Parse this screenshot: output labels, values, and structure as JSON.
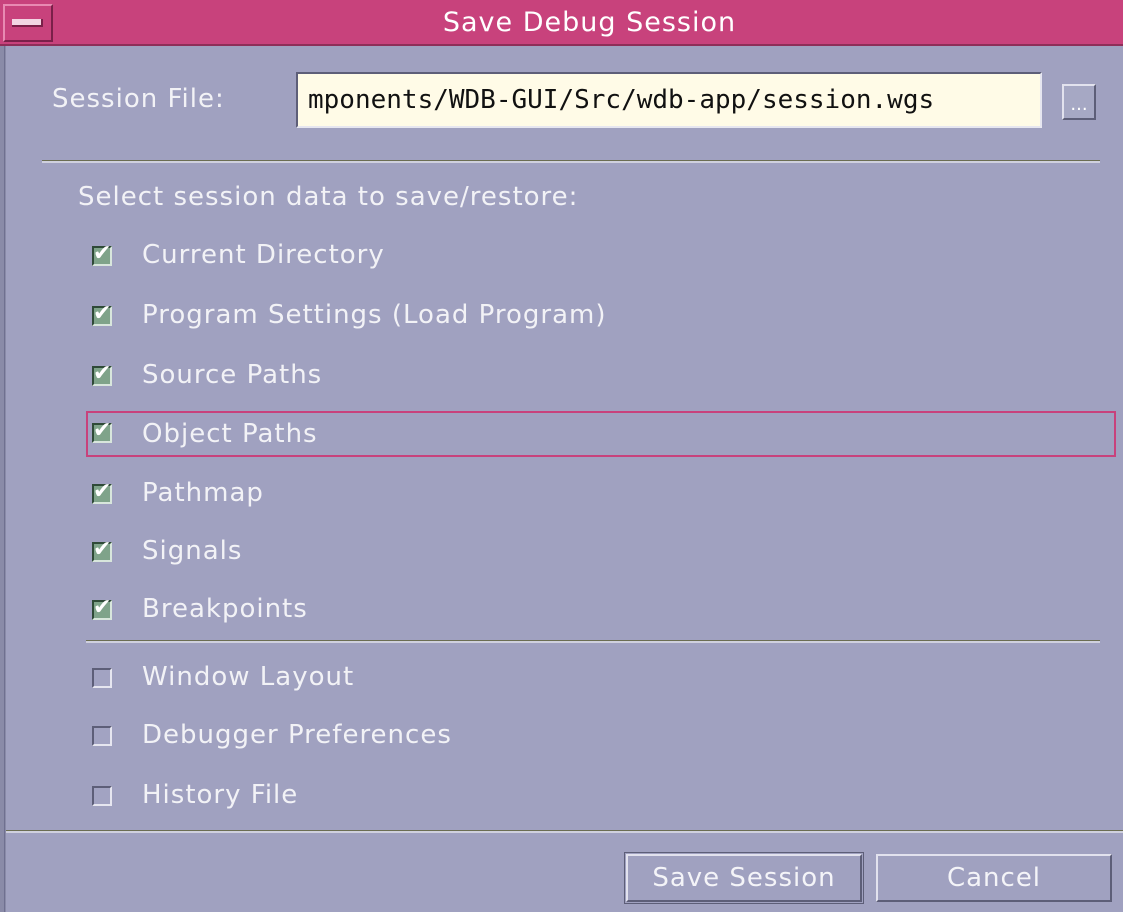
{
  "window": {
    "title": "Save Debug Session"
  },
  "session_file": {
    "label": "Session File:",
    "value": "mponents/WDB-GUI/Src/wdb-app/session.wgs",
    "browse_label": "..."
  },
  "section_heading": "Select session data to save/restore:",
  "options": [
    {
      "label": "Current Directory",
      "checked": true
    },
    {
      "label": "Program Settings (Load Program)",
      "checked": true
    },
    {
      "label": "Source Paths",
      "checked": true
    },
    {
      "label": "Object Paths",
      "checked": true,
      "focused": true
    },
    {
      "label": "Pathmap",
      "checked": true
    },
    {
      "label": "Signals",
      "checked": true
    },
    {
      "label": "Breakpoints",
      "checked": true
    },
    {
      "label": "Window Layout",
      "checked": false
    },
    {
      "label": "Debugger Preferences",
      "checked": false
    },
    {
      "label": "History File",
      "checked": false
    }
  ],
  "buttons": {
    "save": "Save Session",
    "cancel": "Cancel"
  },
  "colors": {
    "titlebar": "#c8427c",
    "background": "#a0a1c0",
    "input_background": "#fffbe7",
    "checkbox_checked": "#7fa38a",
    "focus": "#c8427c"
  }
}
